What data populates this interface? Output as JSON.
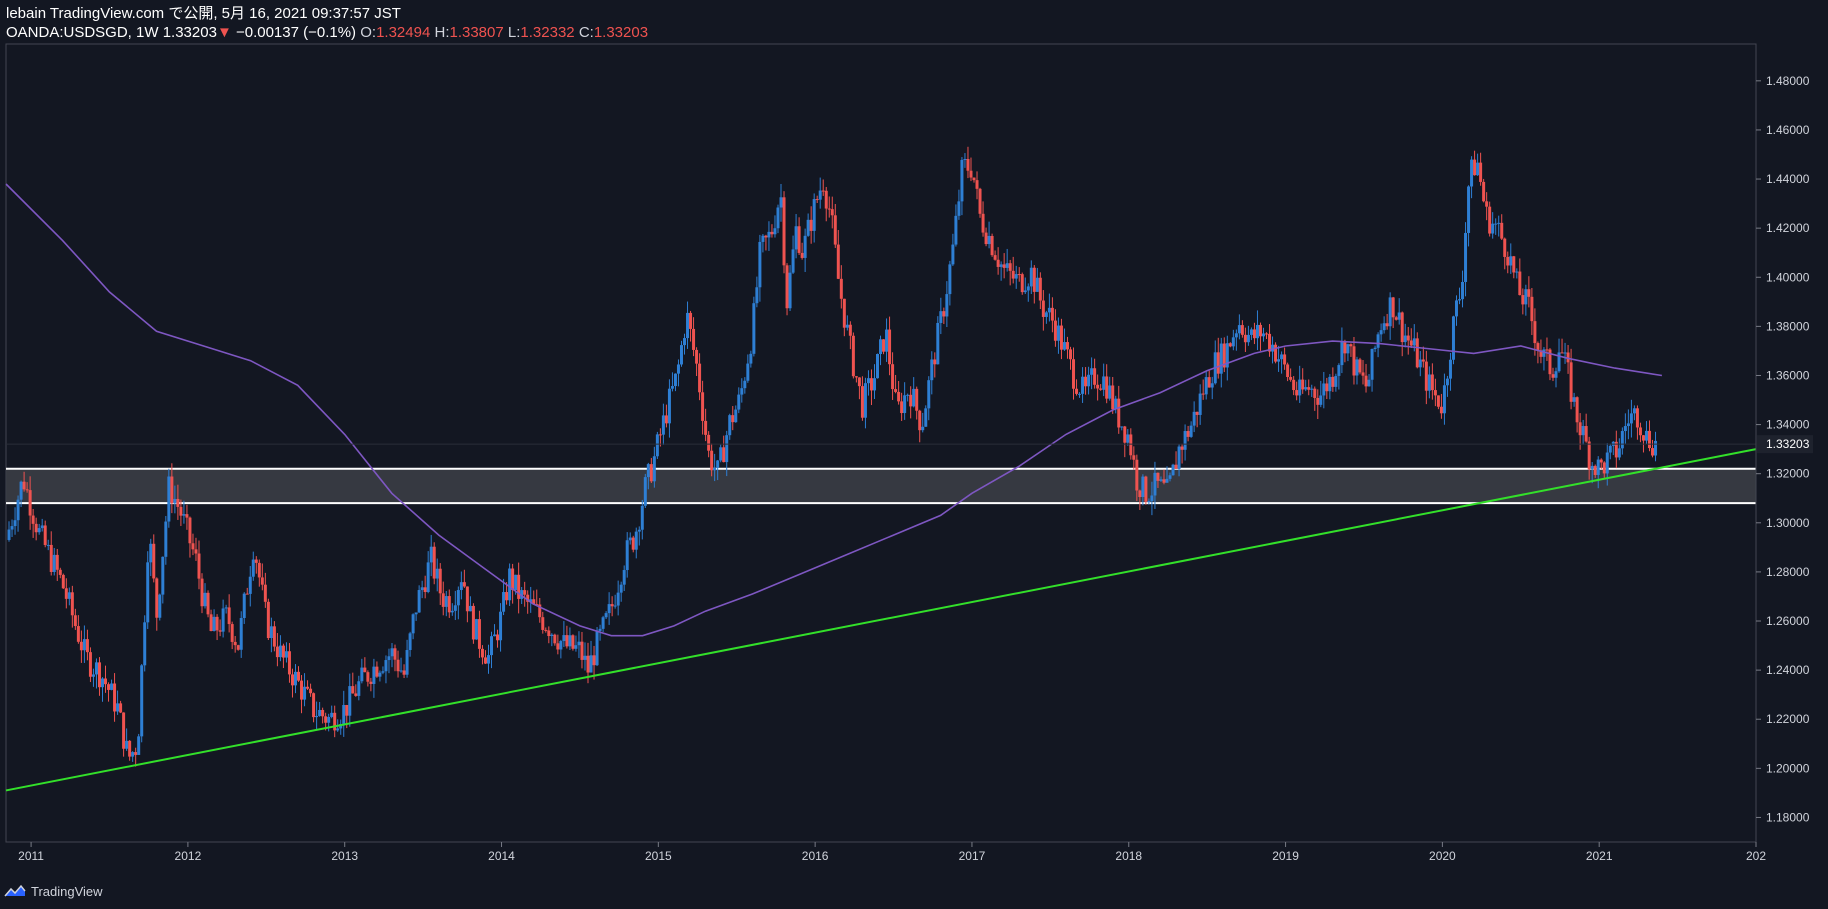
{
  "header": {
    "line1": "lebain TradingView.com で公開, 5月 16, 2021 09:37:57 JST",
    "symbol": "OANDA:USDSGD, 1W",
    "last": "1.33203",
    "change_arrow": "▼",
    "change": "−0.00137 (−0.1%)",
    "o_label": "O:",
    "o": "1.32494",
    "h_label": "H:",
    "h": "1.33807",
    "l_label": "L:",
    "l": "1.32332",
    "c_label": "C:",
    "c": "1.33203"
  },
  "footer": {
    "brand": "TradingView",
    "logo_icon": "tradingview-logo-icon"
  },
  "colors": {
    "background": "#131722",
    "up": "#2e7fd4",
    "down": "#ef5350",
    "ma": "#7e57c2",
    "trendline": "#33e02a",
    "zone_fill": "#3b3d45",
    "zone_border": "#ffffff",
    "axis_text": "#d1d4dc"
  },
  "chart_data": {
    "type": "candlestick",
    "instrument": "OANDA:USDSGD",
    "timeframe": "1W",
    "ylim": [
      1.17,
      1.495
    ],
    "y_ticks": [
      "1.18000",
      "1.20000",
      "1.22000",
      "1.24000",
      "1.26000",
      "1.28000",
      "1.30000",
      "1.32000",
      "1.34000",
      "1.36000",
      "1.38000",
      "1.40000",
      "1.42000",
      "1.44000",
      "1.46000",
      "1.48000"
    ],
    "x_ticks": [
      "2011",
      "2012",
      "2013",
      "2014",
      "2015",
      "2016",
      "2017",
      "2018",
      "2019",
      "2020",
      "2021",
      "202"
    ],
    "x_range": [
      2010.84,
      2022.0
    ],
    "last_price_label": "1.33203",
    "price_path": [
      [
        2010.84,
        1.293
      ],
      [
        2010.95,
        1.318
      ],
      [
        2011.05,
        1.296
      ],
      [
        2011.2,
        1.275
      ],
      [
        2011.35,
        1.245
      ],
      [
        2011.45,
        1.238
      ],
      [
        2011.55,
        1.225
      ],
      [
        2011.62,
        1.204
      ],
      [
        2011.68,
        1.21
      ],
      [
        2011.72,
        1.258
      ],
      [
        2011.75,
        1.298
      ],
      [
        2011.8,
        1.262
      ],
      [
        2011.88,
        1.315
      ],
      [
        2011.95,
        1.305
      ],
      [
        2012.05,
        1.285
      ],
      [
        2012.1,
        1.268
      ],
      [
        2012.15,
        1.255
      ],
      [
        2012.25,
        1.262
      ],
      [
        2012.32,
        1.25
      ],
      [
        2012.38,
        1.275
      ],
      [
        2012.42,
        1.292
      ],
      [
        2012.5,
        1.26
      ],
      [
        2012.6,
        1.245
      ],
      [
        2012.7,
        1.235
      ],
      [
        2012.8,
        1.224
      ],
      [
        2012.9,
        1.22
      ],
      [
        2013.0,
        1.224
      ],
      [
        2013.1,
        1.235
      ],
      [
        2013.2,
        1.242
      ],
      [
        2013.3,
        1.247
      ],
      [
        2013.38,
        1.238
      ],
      [
        2013.45,
        1.265
      ],
      [
        2013.55,
        1.285
      ],
      [
        2013.62,
        1.27
      ],
      [
        2013.68,
        1.268
      ],
      [
        2013.75,
        1.28
      ],
      [
        2013.8,
        1.262
      ],
      [
        2013.85,
        1.253
      ],
      [
        2013.92,
        1.245
      ],
      [
        2014.0,
        1.262
      ],
      [
        2014.05,
        1.278
      ],
      [
        2014.12,
        1.27
      ],
      [
        2014.2,
        1.265
      ],
      [
        2014.3,
        1.258
      ],
      [
        2014.4,
        1.25
      ],
      [
        2014.5,
        1.248
      ],
      [
        2014.55,
        1.24
      ],
      [
        2014.62,
        1.252
      ],
      [
        2014.7,
        1.265
      ],
      [
        2014.78,
        1.285
      ],
      [
        2014.85,
        1.295
      ],
      [
        2014.92,
        1.315
      ],
      [
        2014.97,
        1.325
      ],
      [
        2015.05,
        1.345
      ],
      [
        2015.12,
        1.36
      ],
      [
        2015.18,
        1.385
      ],
      [
        2015.25,
        1.362
      ],
      [
        2015.32,
        1.328
      ],
      [
        2015.38,
        1.32
      ],
      [
        2015.45,
        1.34
      ],
      [
        2015.52,
        1.35
      ],
      [
        2015.6,
        1.378
      ],
      [
        2015.65,
        1.41
      ],
      [
        2015.72,
        1.418
      ],
      [
        2015.78,
        1.435
      ],
      [
        2015.82,
        1.39
      ],
      [
        2015.88,
        1.42
      ],
      [
        2015.92,
        1.41
      ],
      [
        2015.98,
        1.425
      ],
      [
        2016.05,
        1.44
      ],
      [
        2016.1,
        1.425
      ],
      [
        2016.15,
        1.398
      ],
      [
        2016.22,
        1.372
      ],
      [
        2016.3,
        1.348
      ],
      [
        2016.38,
        1.36
      ],
      [
        2016.45,
        1.378
      ],
      [
        2016.52,
        1.345
      ],
      [
        2016.6,
        1.355
      ],
      [
        2016.68,
        1.34
      ],
      [
        2016.75,
        1.365
      ],
      [
        2016.82,
        1.388
      ],
      [
        2016.88,
        1.412
      ],
      [
        2016.94,
        1.445
      ],
      [
        2017.0,
        1.445
      ],
      [
        2017.05,
        1.425
      ],
      [
        2017.12,
        1.415
      ],
      [
        2017.2,
        1.403
      ],
      [
        2017.3,
        1.398
      ],
      [
        2017.38,
        1.402
      ],
      [
        2017.45,
        1.388
      ],
      [
        2017.52,
        1.382
      ],
      [
        2017.58,
        1.372
      ],
      [
        2017.65,
        1.36
      ],
      [
        2017.72,
        1.352
      ],
      [
        2017.78,
        1.36
      ],
      [
        2017.85,
        1.358
      ],
      [
        2017.92,
        1.345
      ],
      [
        2018.0,
        1.335
      ],
      [
        2018.05,
        1.318
      ],
      [
        2018.1,
        1.312
      ],
      [
        2018.18,
        1.315
      ],
      [
        2018.25,
        1.312
      ],
      [
        2018.32,
        1.33
      ],
      [
        2018.4,
        1.34
      ],
      [
        2018.48,
        1.355
      ],
      [
        2018.55,
        1.365
      ],
      [
        2018.62,
        1.37
      ],
      [
        2018.7,
        1.382
      ],
      [
        2018.78,
        1.375
      ],
      [
        2018.85,
        1.378
      ],
      [
        2018.92,
        1.372
      ],
      [
        2019.0,
        1.362
      ],
      [
        2019.08,
        1.352
      ],
      [
        2019.15,
        1.355
      ],
      [
        2019.22,
        1.352
      ],
      [
        2019.3,
        1.36
      ],
      [
        2019.38,
        1.375
      ],
      [
        2019.45,
        1.362
      ],
      [
        2019.52,
        1.355
      ],
      [
        2019.6,
        1.38
      ],
      [
        2019.68,
        1.39
      ],
      [
        2019.75,
        1.378
      ],
      [
        2019.82,
        1.37
      ],
      [
        2019.9,
        1.358
      ],
      [
        2019.95,
        1.352
      ],
      [
        2020.0,
        1.348
      ],
      [
        2020.08,
        1.385
      ],
      [
        2020.12,
        1.395
      ],
      [
        2020.17,
        1.44
      ],
      [
        2020.22,
        1.448
      ],
      [
        2020.28,
        1.425
      ],
      [
        2020.35,
        1.42
      ],
      [
        2020.42,
        1.41
      ],
      [
        2020.48,
        1.395
      ],
      [
        2020.55,
        1.388
      ],
      [
        2020.62,
        1.37
      ],
      [
        2020.7,
        1.362
      ],
      [
        2020.75,
        1.372
      ],
      [
        2020.8,
        1.36
      ],
      [
        2020.85,
        1.345
      ],
      [
        2020.9,
        1.335
      ],
      [
        2020.95,
        1.325
      ],
      [
        2021.0,
        1.322
      ],
      [
        2021.05,
        1.325
      ],
      [
        2021.12,
        1.33
      ],
      [
        2021.18,
        1.342
      ],
      [
        2021.24,
        1.345
      ],
      [
        2021.3,
        1.335
      ],
      [
        2021.36,
        1.332
      ]
    ],
    "ma_path": [
      [
        2010.84,
        1.438
      ],
      [
        2011.2,
        1.415
      ],
      [
        2011.5,
        1.394
      ],
      [
        2011.8,
        1.378
      ],
      [
        2012.1,
        1.372
      ],
      [
        2012.4,
        1.366
      ],
      [
        2012.7,
        1.356
      ],
      [
        2013.0,
        1.336
      ],
      [
        2013.3,
        1.312
      ],
      [
        2013.6,
        1.295
      ],
      [
        2013.9,
        1.281
      ],
      [
        2014.2,
        1.267
      ],
      [
        2014.5,
        1.258
      ],
      [
        2014.7,
        1.254
      ],
      [
        2014.9,
        1.254
      ],
      [
        2015.1,
        1.258
      ],
      [
        2015.3,
        1.264
      ],
      [
        2015.6,
        1.271
      ],
      [
        2015.9,
        1.279
      ],
      [
        2016.2,
        1.287
      ],
      [
        2016.5,
        1.295
      ],
      [
        2016.8,
        1.303
      ],
      [
        2017.0,
        1.312
      ],
      [
        2017.3,
        1.323
      ],
      [
        2017.6,
        1.336
      ],
      [
        2017.9,
        1.346
      ],
      [
        2018.2,
        1.353
      ],
      [
        2018.5,
        1.362
      ],
      [
        2018.8,
        1.369
      ],
      [
        2019.0,
        1.372
      ],
      [
        2019.3,
        1.374
      ],
      [
        2019.6,
        1.373
      ],
      [
        2019.9,
        1.371
      ],
      [
        2020.2,
        1.369
      ],
      [
        2020.5,
        1.372
      ],
      [
        2020.8,
        1.367
      ],
      [
        2021.1,
        1.363
      ],
      [
        2021.4,
        1.36
      ]
    ],
    "trendline": [
      [
        2010.84,
        1.191
      ],
      [
        2022.0,
        1.33
      ]
    ],
    "support_zone": [
      1.308,
      1.322
    ]
  }
}
